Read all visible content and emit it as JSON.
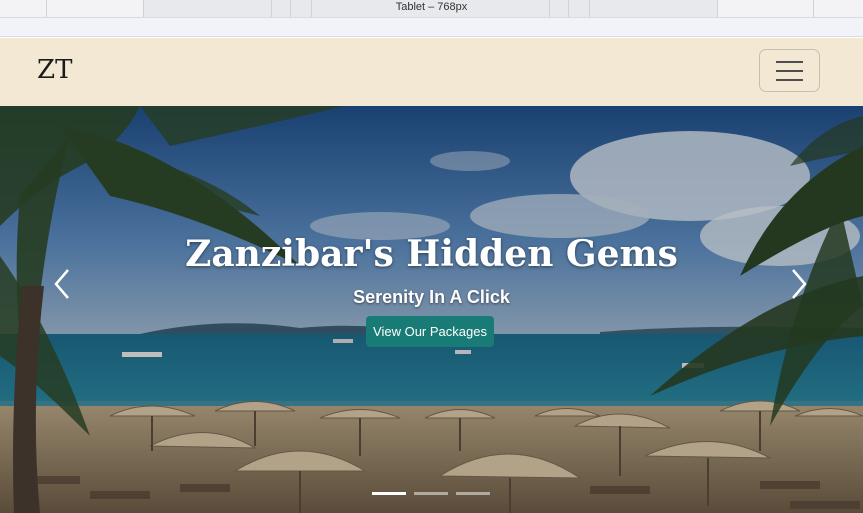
{
  "devtools": {
    "viewport_label": "Tablet – 768px"
  },
  "navbar": {
    "brand": "ZT",
    "toggler_icon": "hamburger-menu-icon"
  },
  "hero": {
    "title": "Zanzibar's Hidden Gems",
    "subtitle": "Serenity In A Click",
    "cta_label": "View Our Packages",
    "prev_icon": "chevron-left-icon",
    "next_icon": "chevron-right-icon",
    "slides": 3,
    "active_slide": 1
  },
  "colors": {
    "nav_bg": "#f2e8d4",
    "cta_bg": "#197b75",
    "text_light": "#ffffff"
  }
}
